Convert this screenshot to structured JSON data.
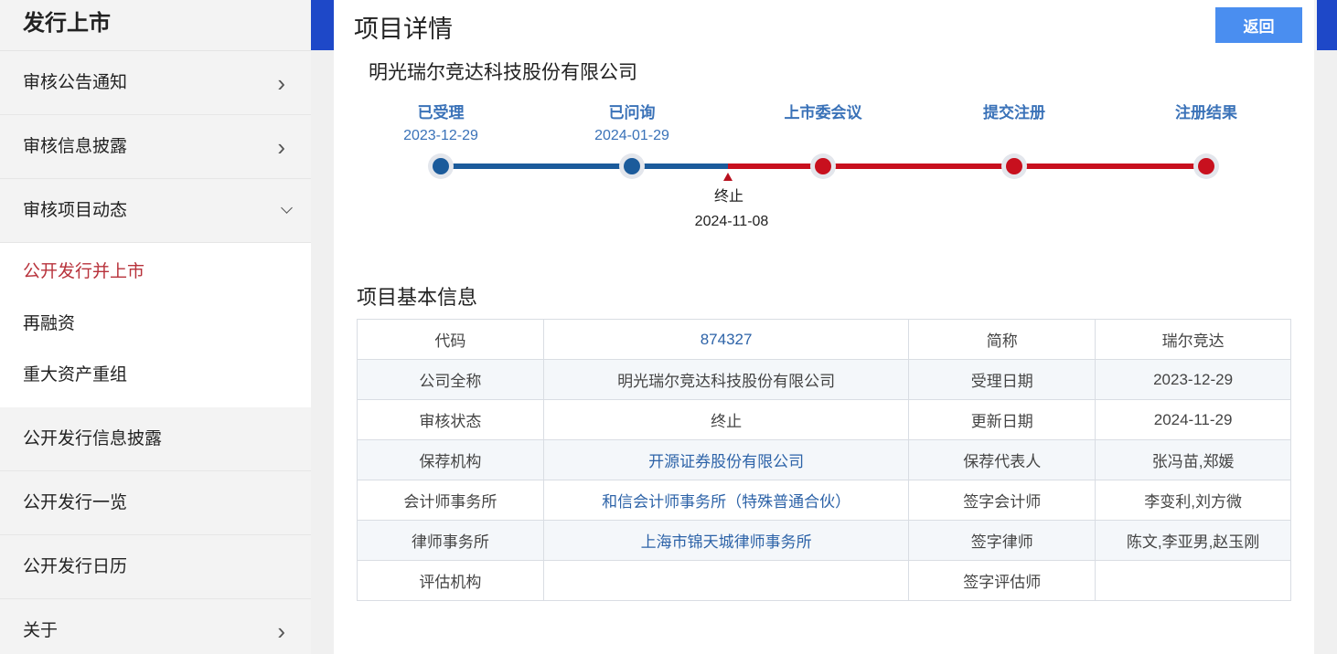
{
  "sidebar": {
    "title": "发行上市",
    "items_top": [
      {
        "label": "审核公告通知",
        "chevron": "right"
      },
      {
        "label": "审核信息披露",
        "chevron": "right"
      },
      {
        "label": "审核项目动态",
        "chevron": "down"
      }
    ],
    "sub_items": [
      {
        "label": "公开发行并上市",
        "active": true
      },
      {
        "label": "再融资",
        "active": false
      },
      {
        "label": "重大资产重组",
        "active": false
      }
    ],
    "items_bottom": [
      {
        "label": "公开发行信息披露"
      },
      {
        "label": "公开发行一览"
      },
      {
        "label": "公开发行日历"
      },
      {
        "label": "关于",
        "chevron": "right"
      }
    ]
  },
  "page": {
    "title": "项目详情",
    "back_label": "返回",
    "company_name": "明光瑞尔竞达科技股份有限公司"
  },
  "timeline": {
    "stages": [
      {
        "label": "已受理",
        "date": "2023-12-29",
        "status": "done"
      },
      {
        "label": "已问询",
        "date": "2024-01-29",
        "status": "done"
      },
      {
        "label": "上市委会议",
        "date": "",
        "status": "pending"
      },
      {
        "label": "提交注册",
        "date": "",
        "status": "pending"
      },
      {
        "label": "注册结果",
        "date": "",
        "status": "pending"
      }
    ],
    "termination": {
      "label": "终止",
      "date": "2024-11-08"
    },
    "colors": {
      "done": "#1b5b9b",
      "pending": "#c8101e"
    }
  },
  "info": {
    "title": "项目基本信息",
    "rows": [
      [
        {
          "text": "代码"
        },
        {
          "text": "874327",
          "link": true
        },
        {
          "text": "简称"
        },
        {
          "text": "瑞尔竞达"
        }
      ],
      [
        {
          "text": "公司全称"
        },
        {
          "text": "明光瑞尔竞达科技股份有限公司"
        },
        {
          "text": "受理日期"
        },
        {
          "text": "2023-12-29"
        }
      ],
      [
        {
          "text": "审核状态"
        },
        {
          "text": "终止"
        },
        {
          "text": "更新日期"
        },
        {
          "text": "2024-11-29"
        }
      ],
      [
        {
          "text": "保荐机构"
        },
        {
          "text": "开源证券股份有限公司",
          "link": true
        },
        {
          "text": "保荐代表人"
        },
        {
          "text": "张冯苗,郑媛"
        }
      ],
      [
        {
          "text": "会计师事务所"
        },
        {
          "text": "和信会计师事务所（特殊普通合伙）",
          "link": true
        },
        {
          "text": "签字会计师"
        },
        {
          "text": "李变利,刘方微"
        }
      ],
      [
        {
          "text": "律师事务所"
        },
        {
          "text": "上海市锦天城律师事务所",
          "link": true
        },
        {
          "text": "签字律师"
        },
        {
          "text": "陈文,李亚男,赵玉刚"
        }
      ],
      [
        {
          "text": "评估机构"
        },
        {
          "text": ""
        },
        {
          "text": "签字评估师"
        },
        {
          "text": ""
        }
      ]
    ]
  },
  "colors": {
    "accent": "#4a8ef0",
    "active_nav": "#b8323b",
    "header_band": "#1e48c8",
    "link": "#2d63a8"
  }
}
